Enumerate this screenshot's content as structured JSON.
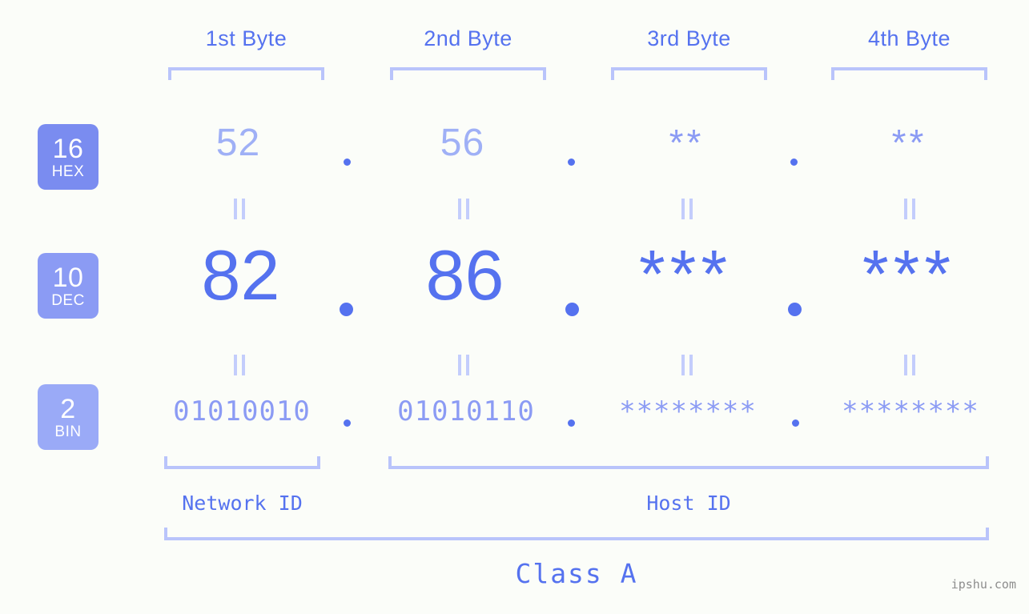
{
  "background": "#fbfdf9",
  "accent": "#5572ef",
  "accent_light": "#8b9bf4",
  "accent_pale": "#b9c4fb",
  "headers": {
    "byte1": "1st Byte",
    "byte2": "2nd Byte",
    "byte3": "3rd Byte",
    "byte4": "4th Byte"
  },
  "bases": [
    {
      "number": "16",
      "name": "HEX",
      "color": "#7a8cf0"
    },
    {
      "number": "10",
      "name": "DEC",
      "color": "#8b9bf4"
    },
    {
      "number": "2",
      "name": "BIN",
      "color": "#9aaaf7"
    }
  ],
  "rows": {
    "hex": {
      "base_number": "16",
      "base_name": "HEX",
      "values": [
        "52",
        "56",
        "**",
        "**"
      ],
      "separator": "."
    },
    "dec": {
      "base_number": "10",
      "base_name": "DEC",
      "values": [
        "82",
        "86",
        "***",
        "***"
      ],
      "separator": "."
    },
    "bin": {
      "base_number": "2",
      "base_name": "BIN",
      "values": [
        "01010010",
        "01010110",
        "********",
        "********"
      ],
      "separator": "."
    }
  },
  "equals_marker": "=",
  "sections": {
    "network_id": "Network ID",
    "host_id": "Host ID",
    "class": "Class A"
  },
  "watermark": "ipshu.com"
}
